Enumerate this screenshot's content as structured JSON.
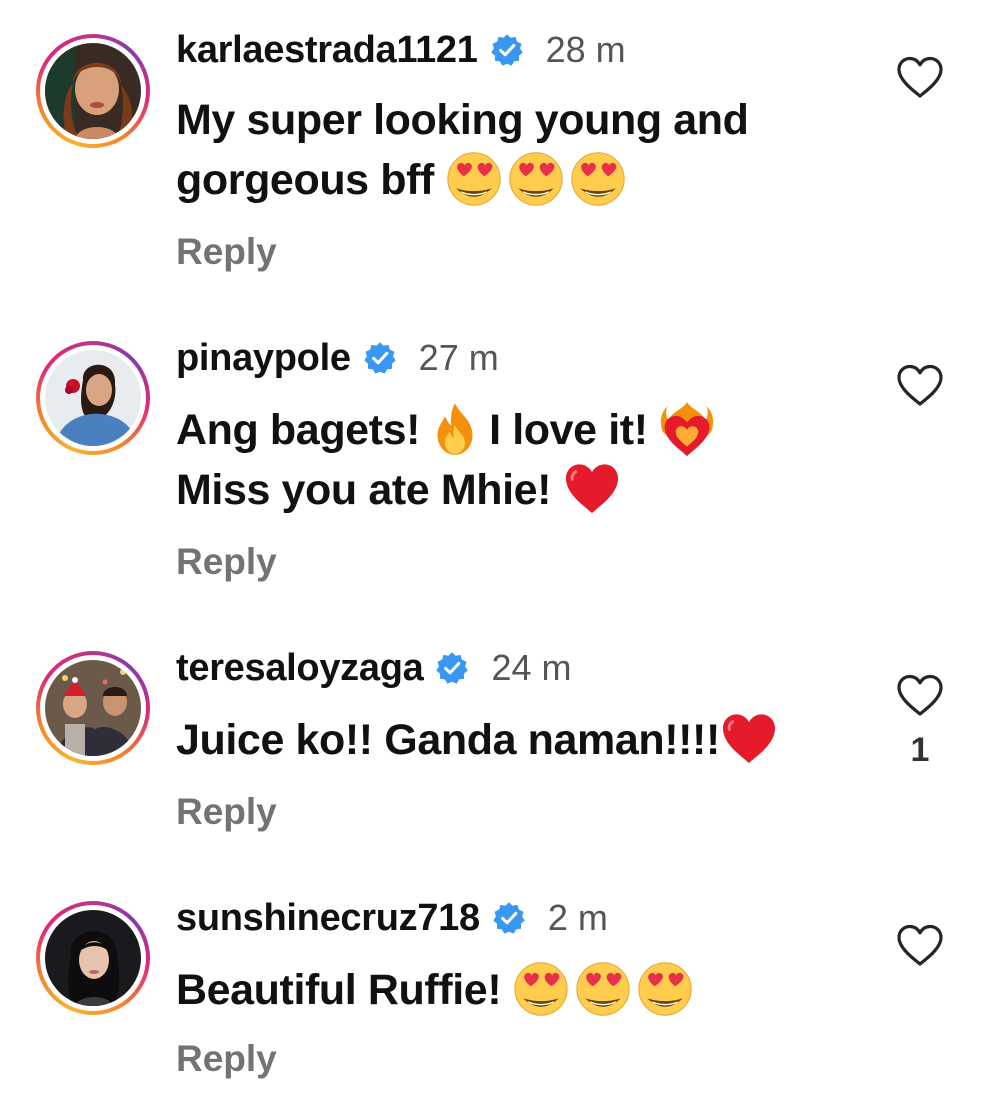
{
  "comments": [
    {
      "username": "karlaestrada1121",
      "verified": true,
      "time": "28 m",
      "text_lines": [
        "My super looking young and",
        "gorgeous bff"
      ],
      "emojis": [
        "heart-eyes-emoji",
        "heart-eyes-emoji",
        "heart-eyes-emoji"
      ],
      "reply_label": "Reply",
      "like_count": ""
    },
    {
      "username": "pinaypole",
      "verified": true,
      "time": "27 m",
      "text_parts": [
        "Ang bagets!",
        "I love it!",
        "Miss you ate Mhie!"
      ],
      "emojis": [
        "fire-emoji",
        "heart-on-fire-emoji",
        "red-heart-emoji"
      ],
      "reply_label": "Reply",
      "like_count": ""
    },
    {
      "username": "teresaloyzaga",
      "verified": true,
      "time": "24 m",
      "text_lines": [
        "Juice ko!! Ganda naman!!!!"
      ],
      "emojis": [
        "red-heart-emoji"
      ],
      "reply_label": "Reply",
      "like_count": "1"
    },
    {
      "username": "sunshinecruz718",
      "verified": true,
      "time": "2 m",
      "text_lines": [
        "Beautiful Ruffie!"
      ],
      "emojis": [
        "heart-eyes-emoji",
        "heart-eyes-emoji",
        "heart-eyes-emoji"
      ],
      "reply_label": "Reply",
      "like_count": ""
    }
  ],
  "colors": {
    "verified_badge": "#3897f0",
    "reply_text": "#737373",
    "timestamp": "#555555",
    "avatar_ring_start": "#f58529",
    "avatar_ring_end": "#dd2a7b"
  }
}
